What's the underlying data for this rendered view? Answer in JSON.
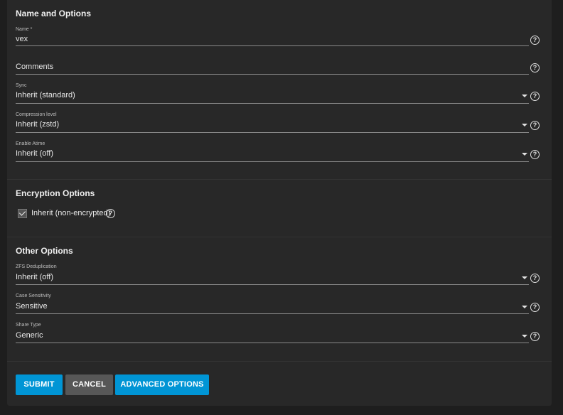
{
  "sections": {
    "name_options": {
      "title": "Name and Options"
    },
    "encryption": {
      "title": "Encryption Options"
    },
    "other": {
      "title": "Other Options"
    }
  },
  "fields": {
    "name": {
      "label": "Name *",
      "value": "vex"
    },
    "comments": {
      "label": "Comments",
      "value": ""
    },
    "sync": {
      "label": "Sync",
      "value": "Inherit (standard)"
    },
    "compression": {
      "label": "Compression level",
      "value": "Inherit (zstd)"
    },
    "atime": {
      "label": "Enable Atime",
      "value": "Inherit (off)"
    },
    "dedup": {
      "label": "ZFS Deduplication",
      "value": "Inherit (off)"
    },
    "case": {
      "label": "Case Sensitivity",
      "value": "Sensitive"
    },
    "share": {
      "label": "Share Type",
      "value": "Generic"
    }
  },
  "encryption": {
    "inherit_label": "Inherit (non-encrypted)",
    "checked": true
  },
  "help_glyph": "?",
  "buttons": {
    "submit": {
      "label": "SUBMIT",
      "color": "#0095d5"
    },
    "cancel": {
      "label": "CANCEL",
      "color": "#575757"
    },
    "advanced": {
      "label": "ADVANCED OPTIONS",
      "color": "#0095d5"
    }
  }
}
